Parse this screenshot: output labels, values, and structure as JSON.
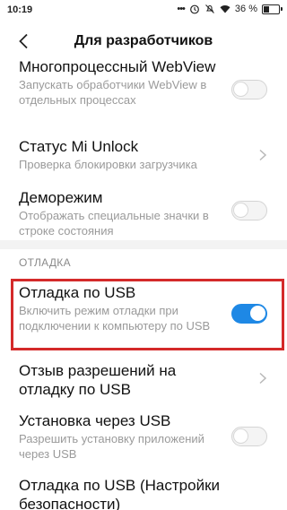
{
  "status_bar": {
    "time": "10:19",
    "battery_text": "36 %",
    "icons": [
      "dots-icon",
      "alarm-icon",
      "silent-icon",
      "wifi-icon",
      "battery-icon"
    ]
  },
  "header": {
    "title": "Для разработчиков",
    "back_icon": "chevron-left-icon"
  },
  "items": [
    {
      "title": "Многопроцессный WebView",
      "subtitle": "Запускать обработчики WebView в отдельных процессах",
      "control": "toggle",
      "checked": false
    },
    {
      "title": "Статус Mi Unlock",
      "subtitle": "Проверка блокировки загрузчика",
      "control": "chevron"
    },
    {
      "title": "Деморежим",
      "subtitle": "Отображать специальные значки в строке состояния",
      "control": "toggle",
      "checked": false
    }
  ],
  "section_debug": {
    "label": "ОТЛАДКА",
    "items": [
      {
        "title": "Отладка по USB",
        "subtitle": "Включить режим отладки при подключении к компьютеру по USB",
        "control": "toggle",
        "checked": true
      },
      {
        "title": "Отзыв разрешений на отладку по USB",
        "control": "chevron"
      },
      {
        "title": "Установка через USB",
        "subtitle": "Разрешить установку приложений через USB",
        "control": "toggle",
        "checked": false
      },
      {
        "title": "Отладка по USB (Настройки безопасности)",
        "control": "none"
      }
    ]
  },
  "colors": {
    "accent": "#1e88e5",
    "highlight_border": "#d42a2a",
    "subtitle": "#9a9a9a",
    "separator": "#f3f3f3"
  }
}
